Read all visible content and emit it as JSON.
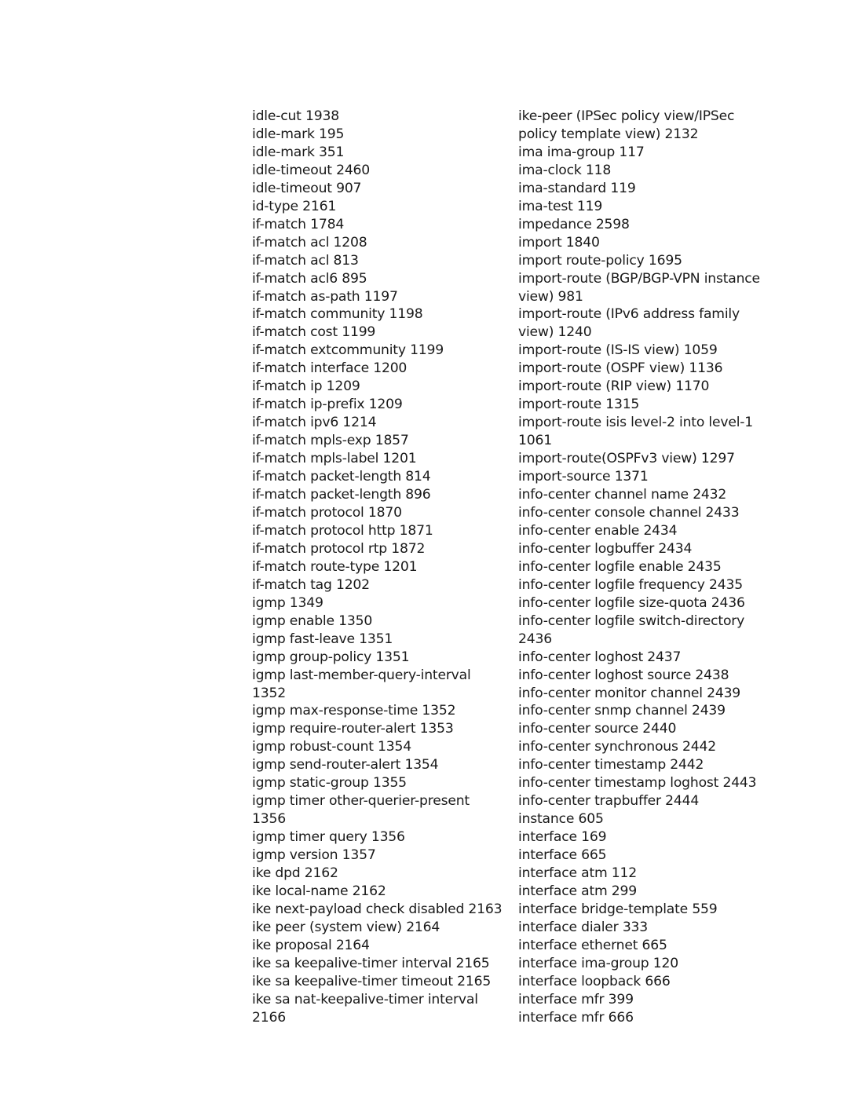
{
  "index": {
    "left_column": [
      "idle-cut 1938",
      "idle-mark 195",
      "idle-mark 351",
      "idle-timeout 2460",
      "idle-timeout 907",
      "id-type 2161",
      "if-match 1784",
      "if-match acl 1208",
      "if-match acl 813",
      "if-match acl6 895",
      "if-match as-path 1197",
      "if-match community 1198",
      "if-match cost 1199",
      "if-match extcommunity 1199",
      "if-match interface 1200",
      "if-match ip 1209",
      "if-match ip-prefix 1209",
      "if-match ipv6 1214",
      "if-match mpls-exp 1857",
      "if-match mpls-label 1201",
      "if-match packet-length 814",
      "if-match packet-length 896",
      "if-match protocol 1870",
      "if-match protocol http 1871",
      "if-match protocol rtp 1872",
      "if-match route-type 1201",
      "if-match tag 1202",
      "igmp 1349",
      "igmp enable 1350",
      "igmp fast-leave 1351",
      "igmp group-policy 1351",
      "igmp last-member-query-interval\n1352",
      "igmp max-response-time 1352",
      "igmp require-router-alert 1353",
      "igmp robust-count 1354",
      "igmp send-router-alert 1354",
      "igmp static-group 1355",
      "igmp timer other-querier-present\n1356",
      "igmp timer query 1356",
      "igmp version 1357",
      "ike dpd 2162",
      "ike local-name 2162",
      "ike next-payload check disabled 2163",
      "ike peer (system view) 2164",
      "ike proposal 2164",
      "ike sa keepalive-timer interval 2165",
      "ike sa keepalive-timer timeout 2165",
      "ike sa nat-keepalive-timer interval\n2166"
    ],
    "right_column": [
      "ike-peer (IPSec policy view/IPSec\npolicy template view) 2132",
      "ima ima-group 117",
      "ima-clock 118",
      "ima-standard 119",
      "ima-test 119",
      "impedance 2598",
      "import 1840",
      "import route-policy 1695",
      "import-route (BGP/BGP-VPN instance\nview) 981",
      "import-route (IPv6 address family\nview) 1240",
      "import-route (IS-IS view) 1059",
      "import-route (OSPF view) 1136",
      "import-route (RIP view) 1170",
      "import-route 1315",
      "import-route isis level-2 into level-1\n1061",
      "import-route(OSPFv3 view) 1297",
      "import-source 1371",
      "info-center channel name 2432",
      "info-center console channel 2433",
      "info-center enable 2434",
      "info-center logbuffer 2434",
      "info-center logfile enable 2435",
      "info-center logfile frequency 2435",
      "info-center logfile size-quota 2436",
      "info-center logfile switch-directory\n2436",
      "info-center loghost 2437",
      "info-center loghost source 2438",
      "info-center monitor channel 2439",
      "info-center snmp channel 2439",
      "info-center source 2440",
      "info-center synchronous 2442",
      "info-center timestamp 2442",
      "info-center timestamp loghost 2443",
      "info-center trapbuffer 2444",
      "instance 605",
      "interface 169",
      "interface 665",
      "interface atm 112",
      "interface atm 299",
      "interface bridge-template 559",
      "interface dialer 333",
      "interface ethernet 665",
      "interface ima-group 120",
      "interface loopback 666",
      "interface mfr 399",
      "interface mfr 666"
    ]
  }
}
